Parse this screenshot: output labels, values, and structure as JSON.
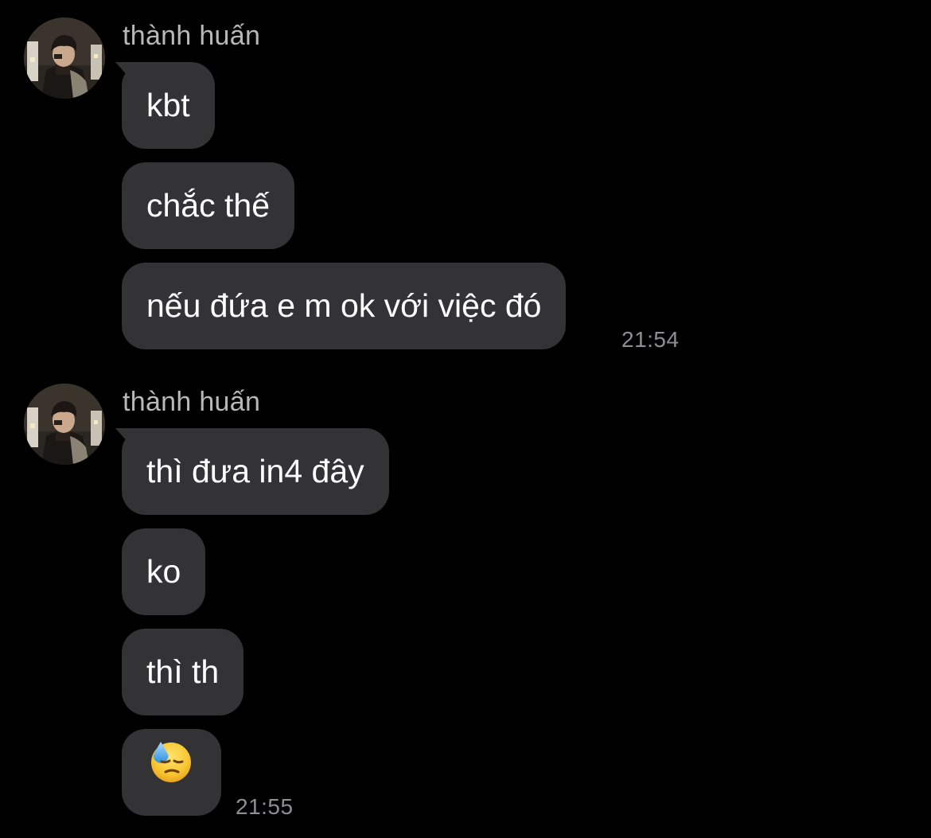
{
  "chat": {
    "groups": [
      {
        "sender": "thành huấn",
        "messages": [
          "kbt",
          "chắc thế",
          "nếu đứa e m ok với việc đó"
        ],
        "time": "21:54"
      },
      {
        "sender": "thành huấn",
        "messages": [
          "thì đưa in4 đây",
          "ko",
          "thì th"
        ],
        "emoji_message": "downcast-face-with-sweat-emoji",
        "time": "21:55"
      }
    ]
  },
  "colors": {
    "background": "#000000",
    "bubble": "#333335",
    "sender_text": "#b8b8b8",
    "timestamp_text": "#8e8e93"
  }
}
